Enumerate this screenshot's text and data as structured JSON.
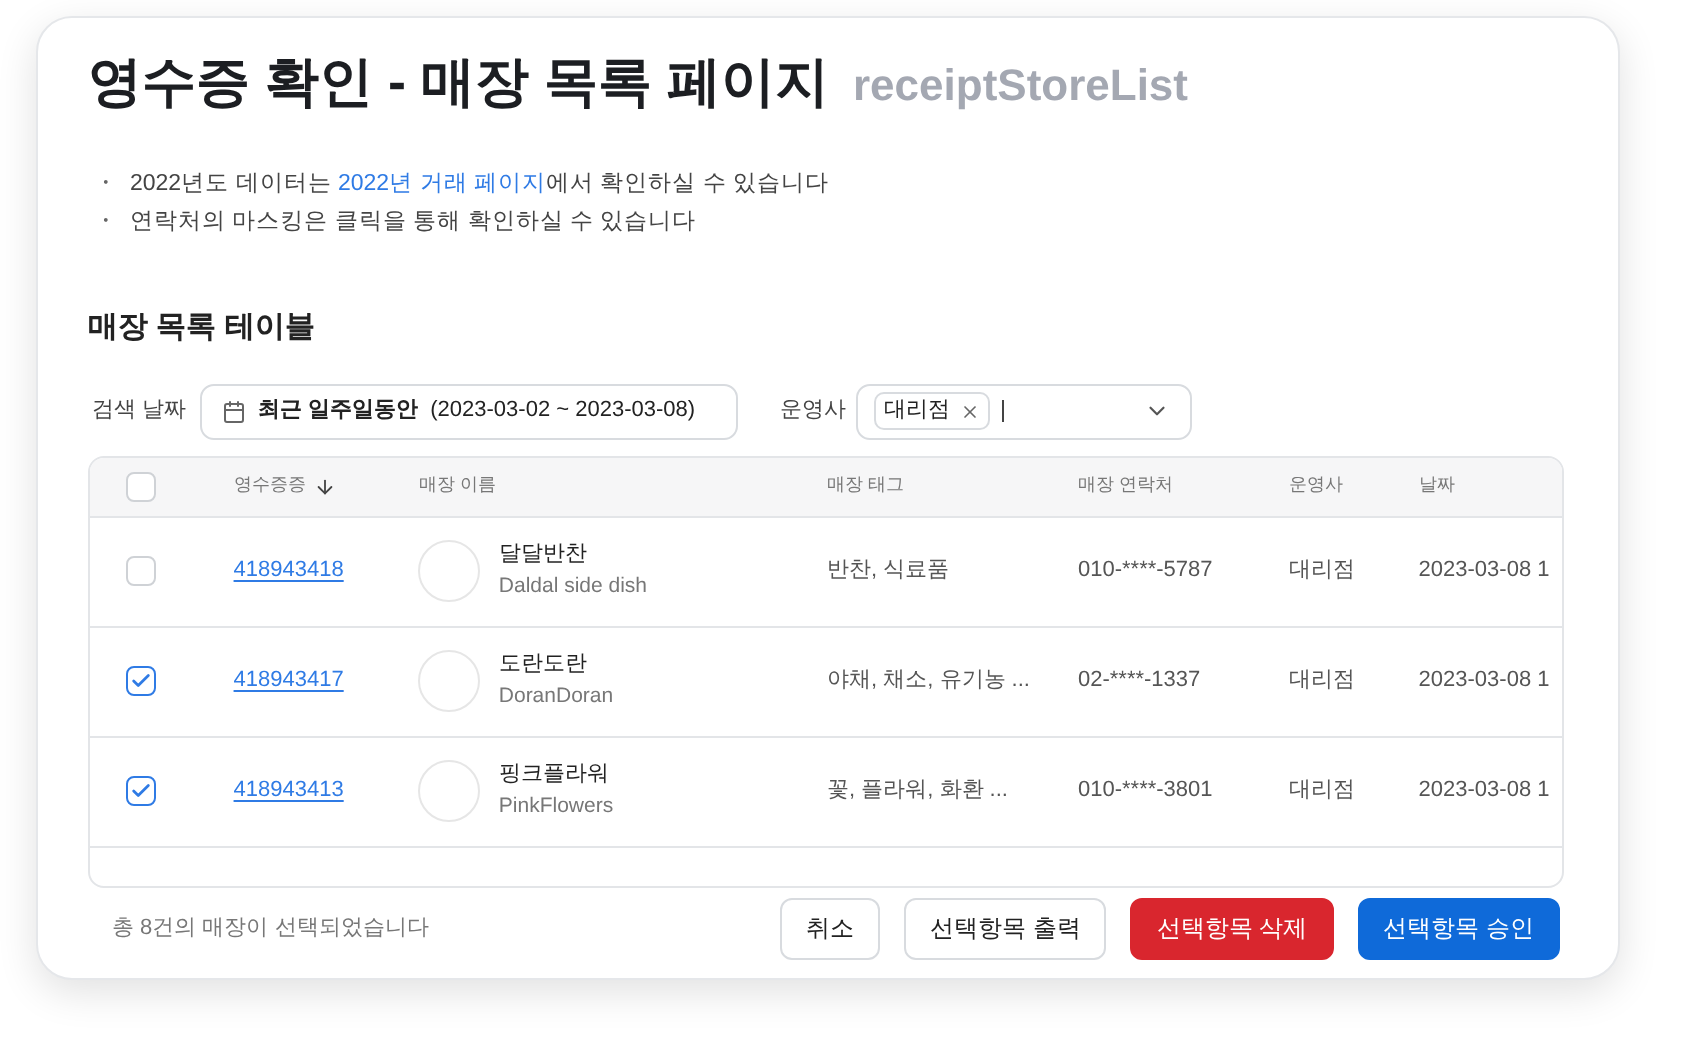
{
  "title": "영수증 확인 - 매장 목록 페이지",
  "subtitle": "receiptStoreList",
  "notes": [
    {
      "before": "2022년도 데이터는 ",
      "link": "2022년 거래 페이지",
      "after": "에서 확인하실 수 있습니다"
    },
    {
      "before": "연락처의 마스킹은 클릭을 통해 확인하실 수 있습니다"
    }
  ],
  "bullet": "・",
  "section_title": "매장 목록 테이블",
  "filters": {
    "date_label": "검색 날짜",
    "date_range_name": "최근 일주일동안",
    "date_range": "(2023-03-02 ~ 2023-03-08)",
    "operator_label": "운영사",
    "operator_tags": [
      "대리점"
    ]
  },
  "table": {
    "all_checked": false,
    "columns": [
      "영수증증",
      "매장 이름",
      "매장 태그",
      "매장 연락처",
      "운영사",
      "날짜"
    ],
    "rows": [
      {
        "checked": false,
        "receipt": "418943418",
        "name": "달달반찬",
        "name_en": "Daldal side dish",
        "tags": "반찬, 식료품",
        "phone": "010-****-5787",
        "operator": "대리점",
        "date": "2023-03-08 1"
      },
      {
        "checked": true,
        "receipt": "418943417",
        "name": "도란도란",
        "name_en": "DoranDoran",
        "tags": "야채, 채소, 유기농 ...",
        "phone": "02-****-1337",
        "operator": "대리점",
        "date": "2023-03-08 1"
      },
      {
        "checked": true,
        "receipt": "418943413",
        "name": "핑크플라워",
        "name_en": "PinkFlowers",
        "tags": "꽃, 플라워, 화환 ...",
        "phone": "010-****-3801",
        "operator": "대리점",
        "date": "2023-03-08 1"
      }
    ]
  },
  "footer": {
    "summary": "총 8건의 매장이 선택되었습니다",
    "buttons": [
      {
        "label": "취소",
        "kind": "plain"
      },
      {
        "label": "선택항목 출력",
        "kind": "plain"
      },
      {
        "label": "선택항목 삭제",
        "kind": "danger"
      },
      {
        "label": "선택항목 승인",
        "kind": "primary"
      }
    ]
  }
}
